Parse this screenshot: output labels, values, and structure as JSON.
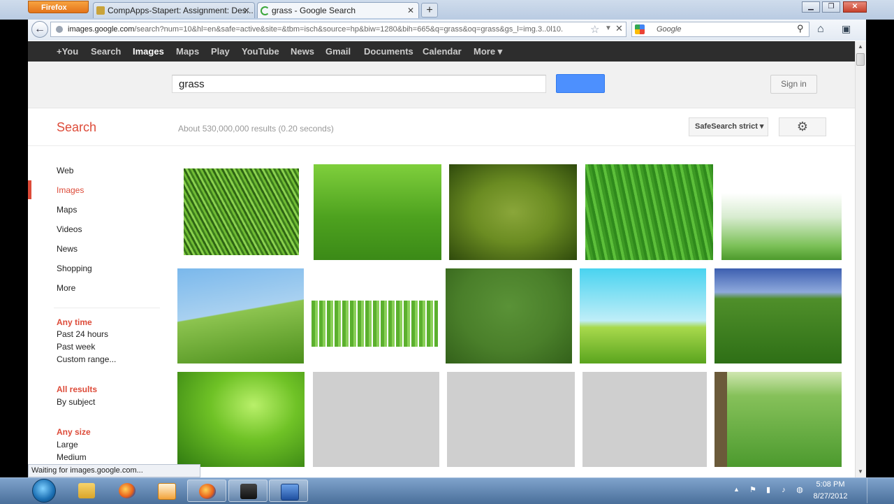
{
  "browser": {
    "menu_label": "Firefox",
    "tabs": [
      {
        "title": "CompApps-Stapert: Assignment: Des..."
      },
      {
        "title": "grass - Google Search"
      }
    ],
    "new_tab": "+",
    "url_domain": "images.google.com",
    "url_rest": "/search?num=10&hl=en&safe=active&site=&tbm=isch&source=hp&biw=1280&bih=665&q=grass&oq=grass&gs_l=img.3..0l10.",
    "search_placeholder": "Google",
    "status": "Waiting for images.google.com..."
  },
  "gbar": {
    "items": [
      "+You",
      "Search",
      "Images",
      "Maps",
      "Play",
      "YouTube",
      "News",
      "Gmail",
      "Documents",
      "Calendar",
      "More ▾"
    ],
    "active": "Images"
  },
  "search": {
    "query": "grass",
    "sign_in": "Sign in",
    "label": "Search",
    "stats": "About 530,000,000 results (0.20 seconds)",
    "safesearch": "SafeSearch strict ▾"
  },
  "left_nav": {
    "items": [
      "Web",
      "Images",
      "Maps",
      "Videos",
      "News",
      "Shopping",
      "More"
    ],
    "active": "Images",
    "time_heading": "Any time",
    "time_options": [
      "Past 24 hours",
      "Past week",
      "Custom range..."
    ],
    "results_heading": "All results",
    "results_options": [
      "By subject"
    ],
    "size_heading": "Any size",
    "size_options": [
      "Large",
      "Medium"
    ]
  },
  "images": {
    "count": 15,
    "loaded": 12,
    "placeholders": 3
  },
  "taskbar": {
    "time": "5:08 PM",
    "date": "8/27/2012"
  },
  "colors": {
    "accent_red": "#dd4b39",
    "search_blue": "#4d90fe",
    "gbar": "#2d2d2d",
    "grass_green": "#4f9a2a"
  }
}
